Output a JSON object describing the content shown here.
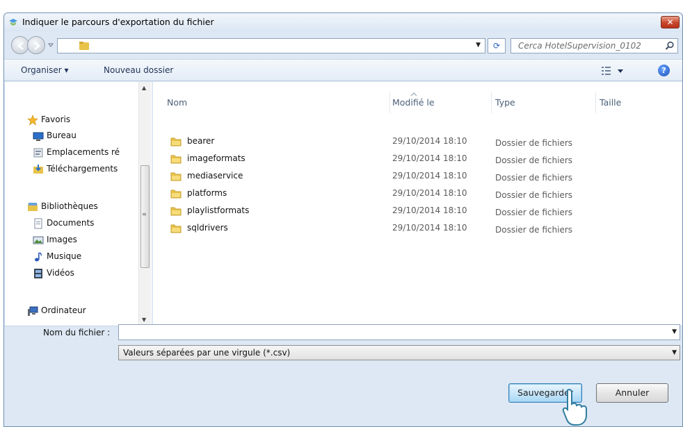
{
  "window": {
    "title": "Indiquer le parcours d'exportation du fichier",
    "close_label": "✕"
  },
  "addressbar": {
    "search_placeholder": "Cerca HotelSupervision_0102"
  },
  "toolbar": {
    "organize_label": "Organiser ▾",
    "new_folder_label": "Nouveau dossier",
    "help_label": "?"
  },
  "nav": {
    "items": [
      {
        "label": "Favoris",
        "icon": "star-icon"
      },
      {
        "label": "Bureau",
        "icon": "desktop-icon"
      },
      {
        "label": "Emplacements ré",
        "icon": "recent-places-icon"
      },
      {
        "label": "Téléchargements",
        "icon": "downloads-icon"
      },
      {
        "label": "Bibliothèques",
        "icon": "libraries-icon"
      },
      {
        "label": "Documents",
        "icon": "documents-icon"
      },
      {
        "label": "Images",
        "icon": "images-icon"
      },
      {
        "label": "Musique",
        "icon": "music-icon"
      },
      {
        "label": "Vidéos",
        "icon": "videos-icon"
      },
      {
        "label": "Ordinateur",
        "icon": "computer-icon"
      }
    ]
  },
  "files": {
    "columns": {
      "name": "Nom",
      "modified": "Modifié le",
      "type": "Type",
      "size": "Taille"
    },
    "rows": [
      {
        "name": "bearer",
        "modified": "29/10/2014 18:10",
        "type": "Dossier de fichiers"
      },
      {
        "name": "imageformats",
        "modified": "29/10/2014 18:10",
        "type": "Dossier de fichiers"
      },
      {
        "name": "mediaservice",
        "modified": "29/10/2014 18:10",
        "type": "Dossier de fichiers"
      },
      {
        "name": "platforms",
        "modified": "29/10/2014 18:10",
        "type": "Dossier de fichiers"
      },
      {
        "name": "playlistformats",
        "modified": "29/10/2014 18:10",
        "type": "Dossier de fichiers"
      },
      {
        "name": "sqldrivers",
        "modified": "29/10/2014 18:10",
        "type": "Dossier de fichiers"
      }
    ]
  },
  "form": {
    "filename_label": "Nom du fichier :",
    "filename_value": "",
    "filetype_value": "Valeurs séparées par une virgule (*.csv)",
    "save_label": "Sauvegarder",
    "cancel_label": "Annuler"
  },
  "colors": {
    "folder": "#e8c34a",
    "accent": "#3c7fb1",
    "chrome": "#dde8f4"
  }
}
